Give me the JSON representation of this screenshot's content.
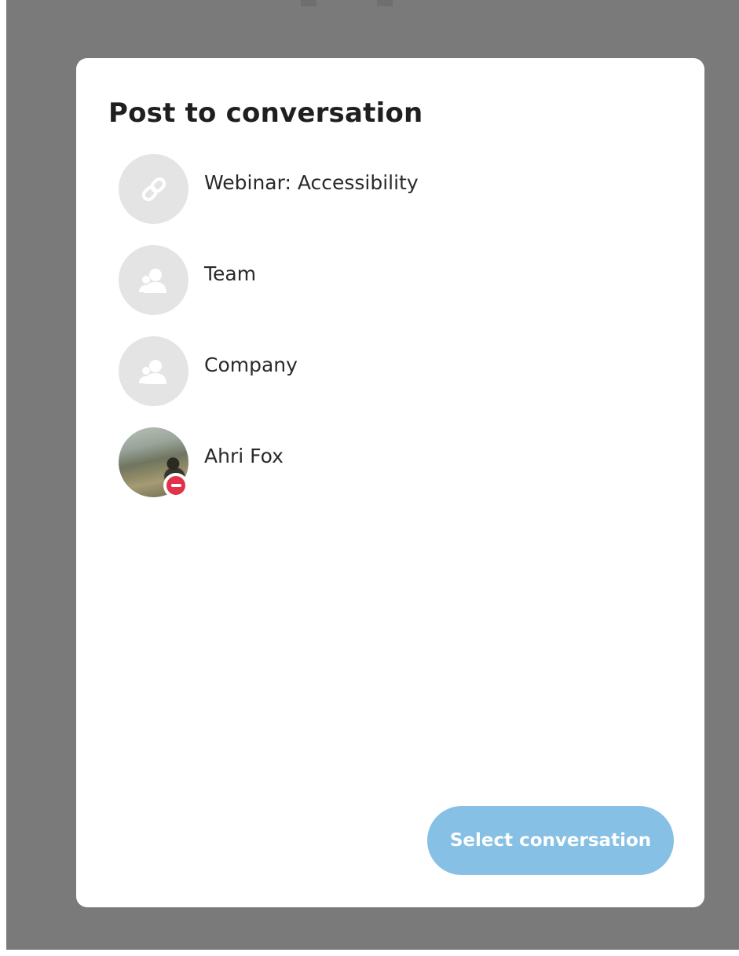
{
  "dialog": {
    "title": "Post to conversation",
    "conversations": [
      {
        "label": "Webinar: Accessibility",
        "icon": "link-icon"
      },
      {
        "label": "Team",
        "icon": "group-icon"
      },
      {
        "label": "Company",
        "icon": "group-icon"
      },
      {
        "label": "Ahri Fox",
        "icon": "user-photo",
        "status": "do-not-disturb"
      }
    ],
    "primary_button": {
      "label": "Select conversation",
      "state": "disabled"
    }
  },
  "colors": {
    "overlay": "#7a7a7a",
    "dialog_background": "#ffffff",
    "avatar_placeholder": "#e4e4e4",
    "button_disabled": "#86c0e4",
    "status_dnd": "#e0334b"
  }
}
